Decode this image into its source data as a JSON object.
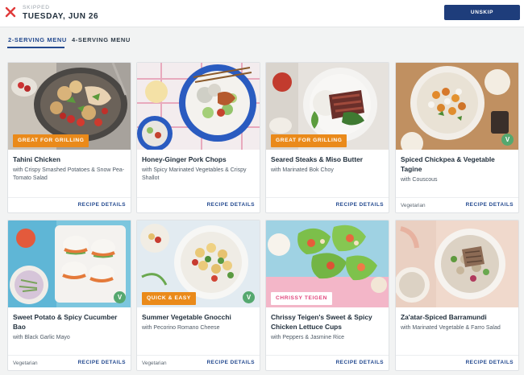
{
  "header": {
    "status_label": "SKIPPED",
    "date": "TUESDAY, JUN 26",
    "unskip_label": "UNSKIP",
    "close_icon": "x-icon",
    "close_icon_color": "#e03a3a",
    "accent_color": "#1e3d7b"
  },
  "tabs": [
    {
      "label": "2-SERVING MENU",
      "active": true
    },
    {
      "label": "4-SERVING MENU",
      "active": false
    }
  ],
  "recipes": [
    {
      "title": "Tahini Chicken",
      "subtitle": "with Crispy Smashed Potatoes & Snow Pea-Tomato Salad",
      "badge": "GREAT FOR GRILLING",
      "dietary": "",
      "details_label": "RECIPE DETAILS"
    },
    {
      "title": "Honey-Ginger Pork Chops",
      "subtitle": "with Spicy Marinated Vegetables & Crispy Shallot",
      "badge": "",
      "dietary": "",
      "details_label": "RECIPE DETAILS"
    },
    {
      "title": "Seared Steaks & Miso Butter",
      "subtitle": "with Marinated Bok Choy",
      "badge": "GREAT FOR GRILLING",
      "dietary": "",
      "details_label": "RECIPE DETAILS"
    },
    {
      "title": "Spiced Chickpea & Vegetable Tagine",
      "subtitle": "with Couscous",
      "badge": "",
      "dietary": "Vegetarian",
      "veg_mark": "V",
      "details_label": "RECIPE DETAILS"
    },
    {
      "title": "Sweet Potato & Spicy Cucumber Bao",
      "subtitle": "with Black Garlic Mayo",
      "badge": "",
      "dietary": "Vegetarian",
      "veg_mark": "V",
      "details_label": "RECIPE DETAILS"
    },
    {
      "title": "Summer Vegetable Gnocchi",
      "subtitle": "with Pecorino Romano Cheese",
      "badge": "QUICK & EASY",
      "dietary": "Vegetarian",
      "veg_mark": "V",
      "details_label": "RECIPE DETAILS"
    },
    {
      "title": "Chrissy Teigen's Sweet & Spicy Chicken Lettuce Cups",
      "subtitle": "with Peppers & Jasmine Rice",
      "badge": "CHRISSY TEIGEN",
      "dietary": "",
      "details_label": "RECIPE DETAILS"
    },
    {
      "title": "Za'atar-Spiced Barramundi",
      "subtitle": "with Marinated Vegetable & Farro Salad",
      "badge": "",
      "dietary": "",
      "details_label": "RECIPE DETAILS"
    }
  ]
}
